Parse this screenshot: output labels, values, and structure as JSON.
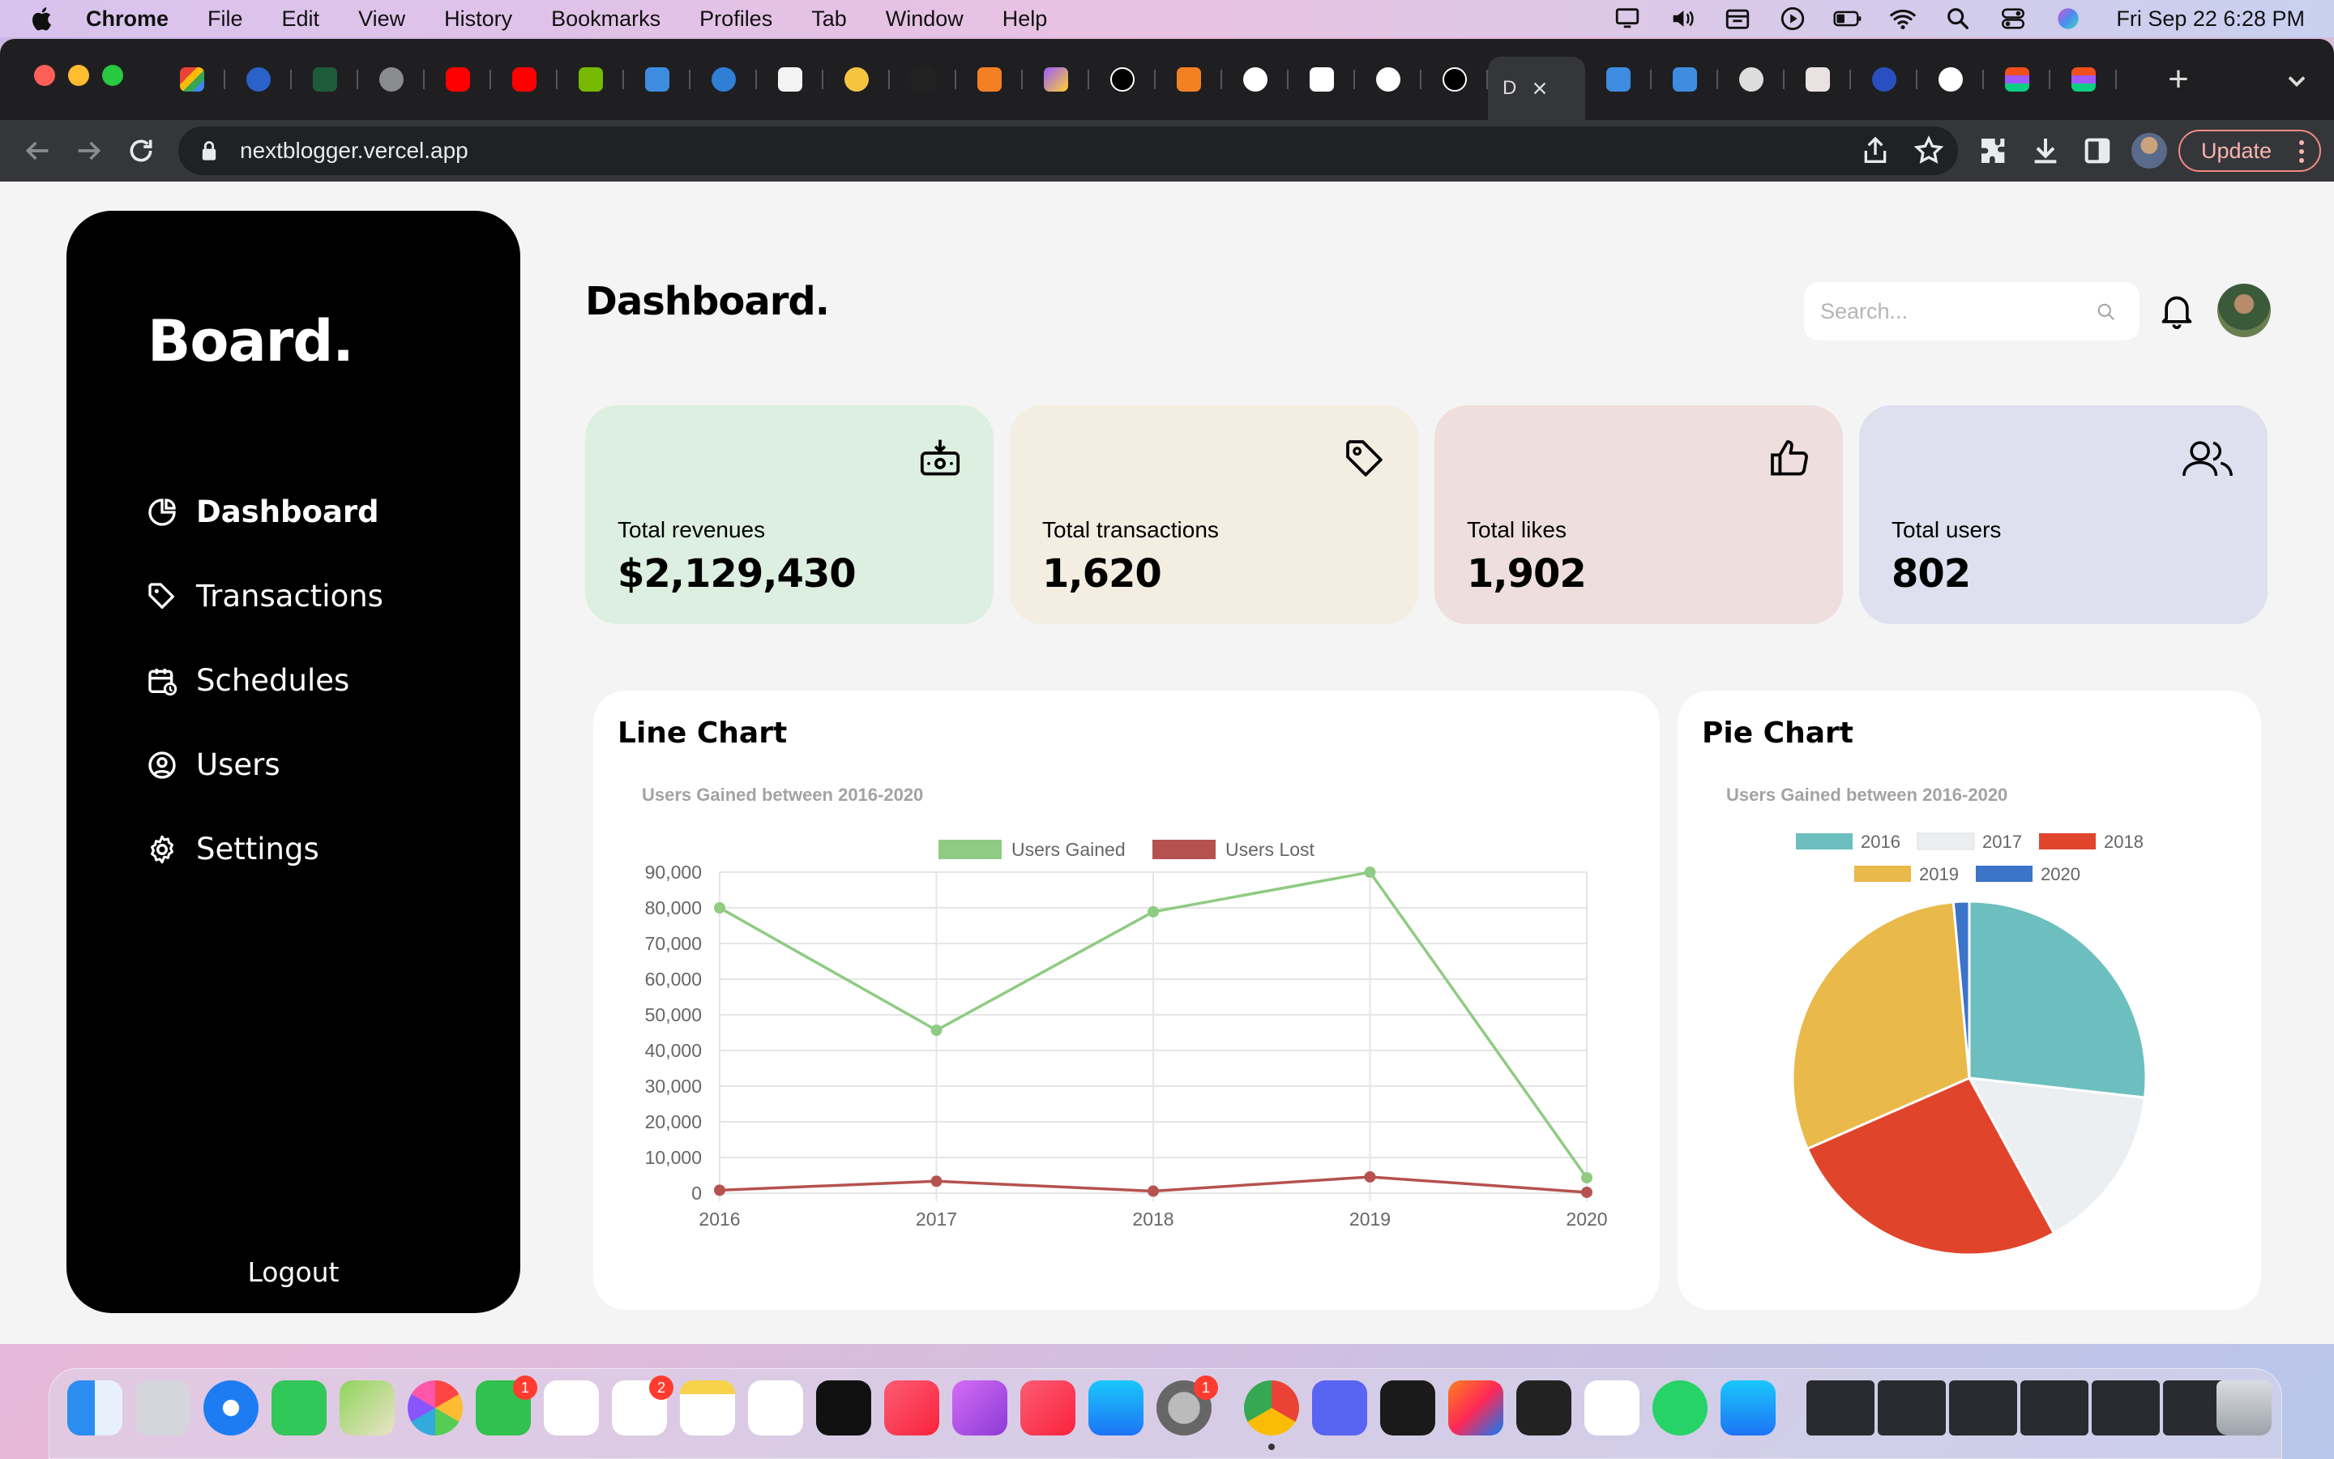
{
  "menubar": {
    "app": "Chrome",
    "items": [
      "File",
      "Edit",
      "View",
      "History",
      "Bookmarks",
      "Profiles",
      "Tab",
      "Window",
      "Help"
    ],
    "clock": "Fri Sep 22  6:28 PM"
  },
  "browser": {
    "active_tab_label": "D",
    "url": "nextblogger.vercel.app",
    "update_label": "Update"
  },
  "sidebar": {
    "brand": "Board.",
    "items": [
      {
        "label": "Dashboard",
        "icon": "pie-icon",
        "active": true
      },
      {
        "label": "Transactions",
        "icon": "tag-icon",
        "active": false
      },
      {
        "label": "Schedules",
        "icon": "calendar-icon",
        "active": false
      },
      {
        "label": "Users",
        "icon": "user-circle-icon",
        "active": false
      },
      {
        "label": "Settings",
        "icon": "gear-icon",
        "active": false
      }
    ],
    "logout": "Logout"
  },
  "header": {
    "title": "Dashboard.",
    "search_placeholder": "Search..."
  },
  "stats": [
    {
      "label": "Total revenues",
      "value": "$2,129,430",
      "icon": "money-box-icon",
      "color": "#ddefe0"
    },
    {
      "label": "Total transactions",
      "value": "1,620",
      "icon": "tag-icon",
      "color": "#f4ede1"
    },
    {
      "label": "Total likes",
      "value": "1,902",
      "icon": "thumbs-up-icon",
      "color": "#eedede"
    },
    {
      "label": "Total users",
      "value": "802",
      "icon": "users-icon",
      "color": "#dee0ef"
    }
  ],
  "panels": {
    "line_title": "Line Chart",
    "pie_title": "Pie Chart"
  },
  "chart_data": [
    {
      "type": "line",
      "title": "Users Gained between 2016-2020",
      "x": [
        "2016",
        "2017",
        "2018",
        "2019",
        "2020"
      ],
      "series": [
        {
          "name": "Users Gained",
          "values": [
            80000,
            45677,
            78888,
            90000,
            4300
          ],
          "color": "#8fcb83"
        },
        {
          "name": "Users Lost",
          "values": [
            823,
            3345,
            555,
            4555,
            234
          ],
          "color": "#b5524f"
        }
      ],
      "ylim": [
        0,
        90000
      ],
      "yticks": [
        0,
        10000,
        20000,
        30000,
        40000,
        50000,
        60000,
        70000,
        80000,
        90000
      ],
      "ytick_labels": [
        "0",
        "10,000",
        "20,000",
        "30,000",
        "40,000",
        "50,000",
        "60,000",
        "70,000",
        "80,000",
        "90,000"
      ],
      "grid": true,
      "legend": "top"
    },
    {
      "type": "pie",
      "title": "Users Gained between 2016-2020",
      "categories": [
        "2016",
        "2017",
        "2018",
        "2019",
        "2020"
      ],
      "values": [
        80000,
        45677,
        78888,
        90000,
        4300
      ],
      "colors": [
        "#6dbfbf",
        "#eceff1",
        "#e0452c",
        "#e9b94a",
        "#3b74c9"
      ],
      "legend": "top"
    }
  ]
}
